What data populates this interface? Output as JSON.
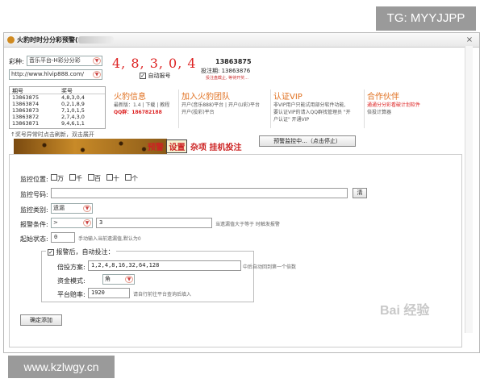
{
  "overlay": {
    "tg": "TG: MYYJJPP",
    "site": "www.kzlwgy.cn"
  },
  "window": {
    "title": "火豹时时分分彩预警(v1.5)",
    "close": "×"
  },
  "lottery": {
    "label": "彩种:",
    "value": "音乐平台-H彩分分彩",
    "url": "http://www.hlvip888.com/"
  },
  "draw": {
    "numbers": "4, 8, 3, 0, 4",
    "auto_label": "自动报号",
    "period": "13863875",
    "next_label": "投注期:",
    "next_period": "13863876",
    "status": "投注盘截止, 等待开奖..."
  },
  "history": {
    "headers": [
      "期号",
      "奖号"
    ],
    "rows": [
      [
        "13863875",
        "4,8,3,0,4"
      ],
      [
        "13863874",
        "0,2,1,8,9"
      ],
      [
        "13863873",
        "7,1,0,1,5"
      ],
      [
        "13863872",
        "2,7,4,3,0"
      ],
      [
        "13863871",
        "9,4,6,1,1"
      ]
    ]
  },
  "info": {
    "p1": {
      "title": "火豹信息",
      "line1": "最新版：1.4 | 下载 | 教程",
      "line2": "QQ群：186782188"
    },
    "p2": {
      "title": "加入火豹团队",
      "line1": "开户(音乐888)平台 | 开户(U彩)平台",
      "line2": "开户(投彩)平台"
    },
    "p3": {
      "title": "认证VIP",
      "line1": "非VIP用户只能试用部分软件功能,",
      "line2": "要认证VIP的请入QQ群找管理员 \"开",
      "line3": "户认证\" 开通VIP"
    },
    "p4": {
      "title": "合作伙伴",
      "line1": "通通分分彩看破计划软件",
      "line2": "倍投计算器"
    }
  },
  "hint_bar": "↑奖号异常时点击刷新，双击展开",
  "tabs": {
    "t1": "预警",
    "t2": "设置",
    "t3": "杂项",
    "t4": "挂机投注"
  },
  "monitor_button": "预警监控中...（点击停止）",
  "form": {
    "position_label": "监控位置:",
    "positions": [
      "万",
      "千",
      "百",
      "十",
      "个"
    ],
    "number_label": "监控号码:",
    "clear": "清",
    "type_label": "监控类别:",
    "type_value": "遗漏",
    "cond_label": "报警条件:",
    "cond_op": ">",
    "cond_value": "3",
    "cond_hint": "当遗漏值大于等于 时触发报警",
    "start_label": "起始状态:",
    "start_value": "0",
    "start_hint": "手动输入当前遗漏值,默认为0",
    "after_label": "报警后，自动投注：",
    "plan_label": "倍投方案:",
    "plan_value": "1,2,4,8,16,32,64,128",
    "plan_hint": "中后自动回到第一个倍数",
    "mode_label": "资金模式:",
    "mode_value": "角",
    "freq_label": "平台赔率:",
    "freq_value": "1920",
    "freq_hint": "请自行前往平台查询后填入",
    "confirm": "确定添加"
  },
  "watermark": "Bai 经验"
}
